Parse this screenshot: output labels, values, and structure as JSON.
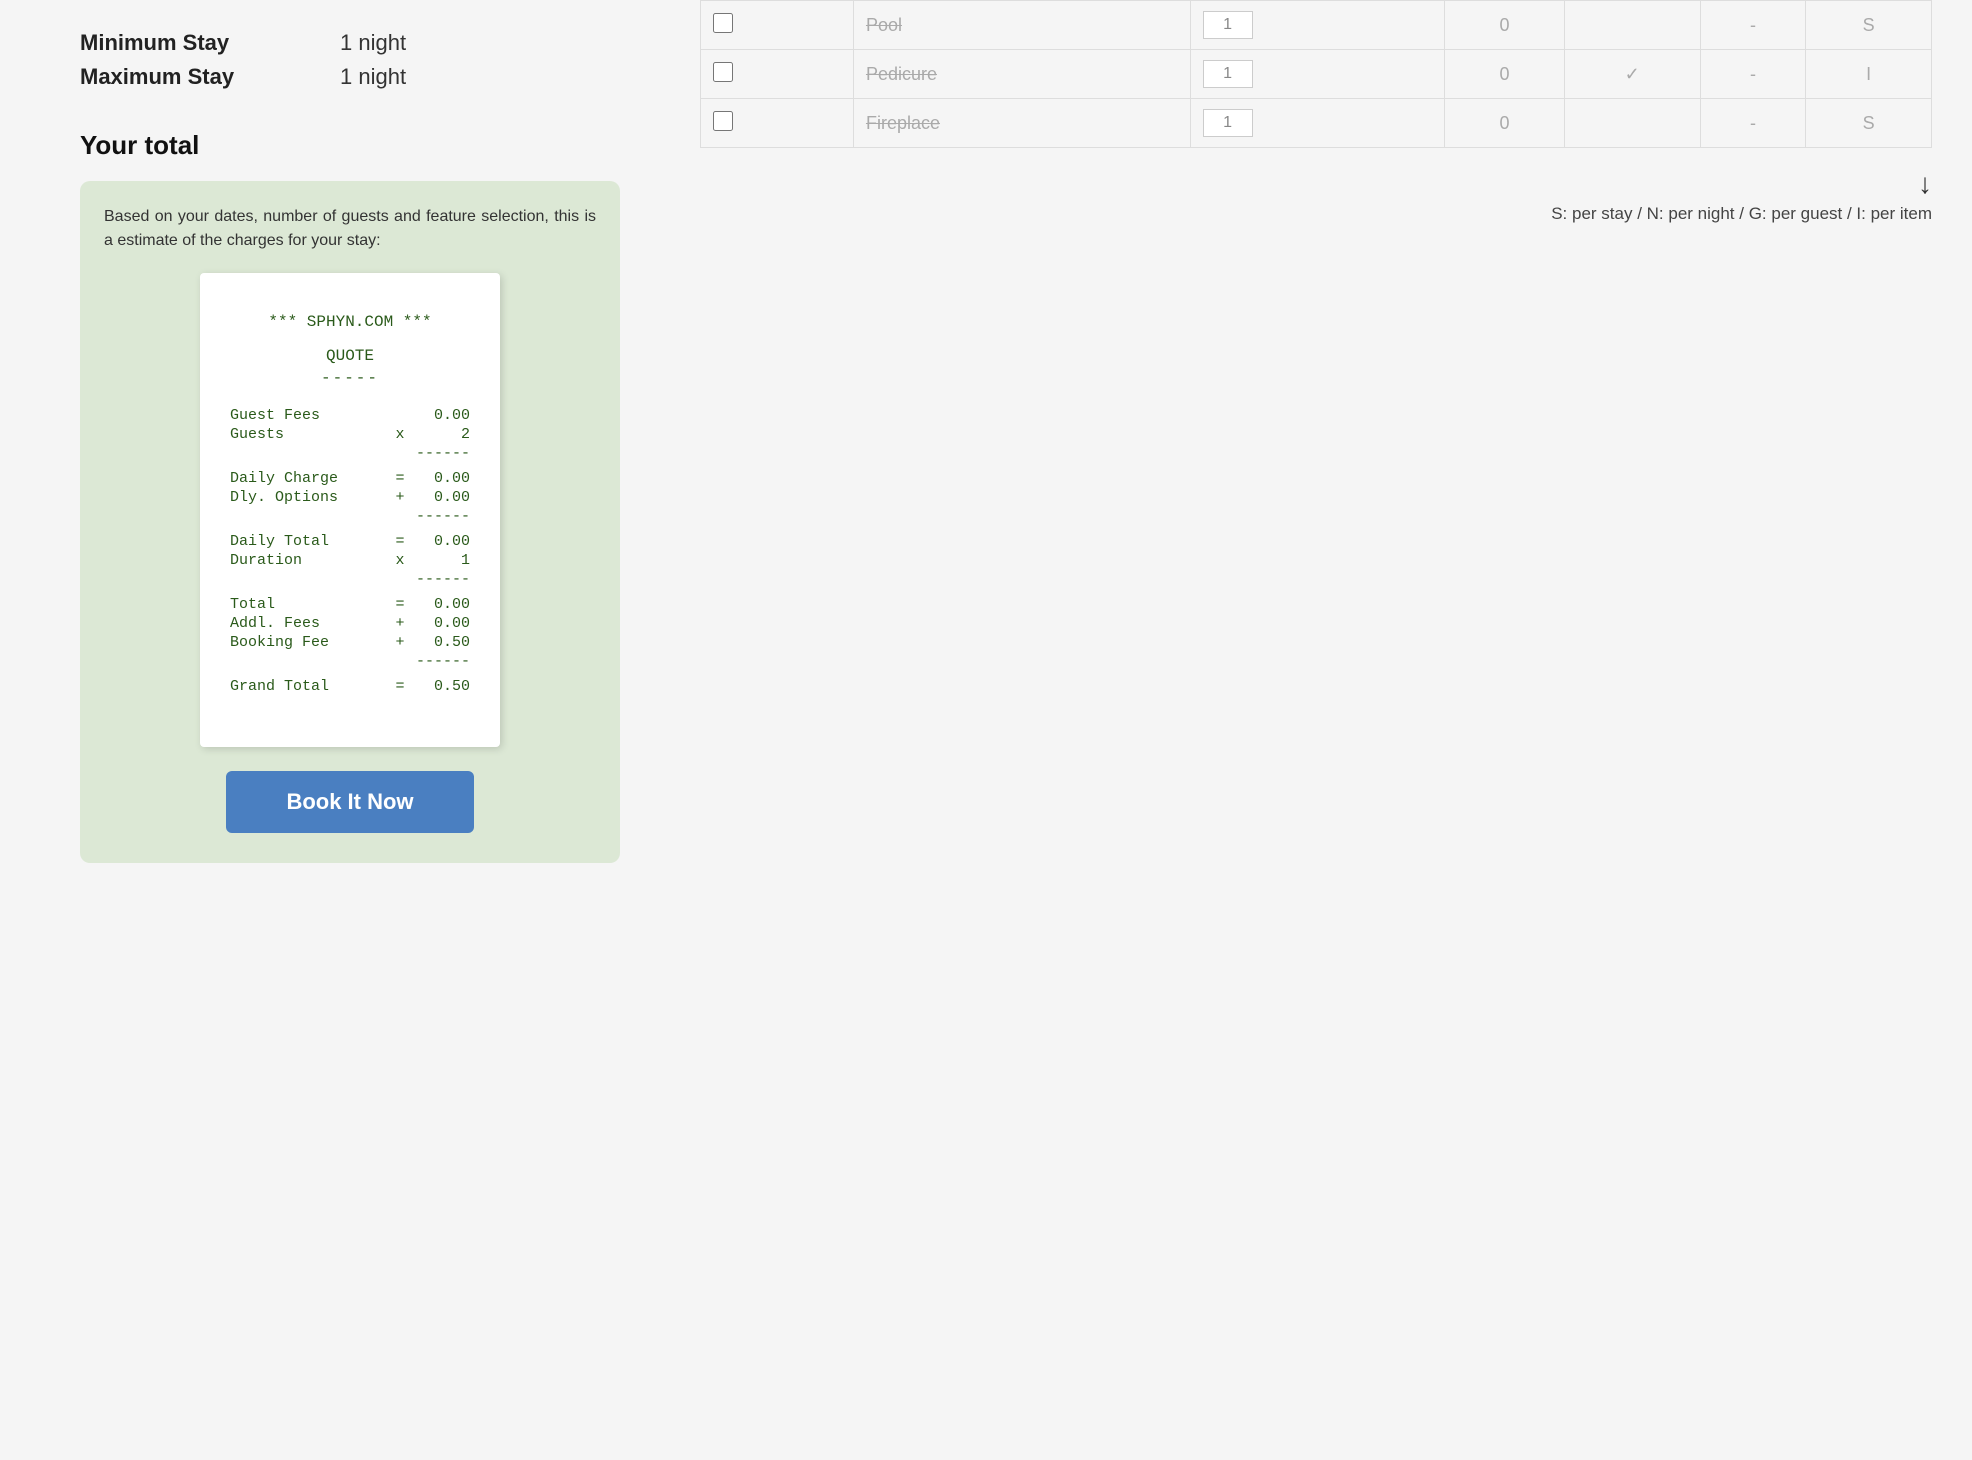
{
  "left": {
    "stay": {
      "min_label": "Minimum Stay",
      "min_value": "1 night",
      "max_label": "Maximum Stay",
      "max_value": "1 night"
    },
    "your_total_label": "Your total",
    "description": "Based on your dates, number of guests and feature selection, this is a estimate of the charges for your stay:",
    "receipt": {
      "header": "*** SPHYN.COM ***",
      "title": "QUOTE",
      "divider_short": "-----",
      "lines": [
        {
          "label": "Guest Fees",
          "op": "",
          "value": "0.00"
        },
        {
          "label": "Guests",
          "op": "x",
          "value": "2"
        },
        {
          "sep1": "------"
        },
        {
          "label": "Daily Charge",
          "op": "=",
          "value": "0.00"
        },
        {
          "label": "Dly. Options",
          "op": "+",
          "value": "0.00"
        },
        {
          "sep2": "------"
        },
        {
          "label": "Daily Total",
          "op": "=",
          "value": "0.00"
        },
        {
          "label": "Duration",
          "op": "x",
          "value": "1"
        },
        {
          "sep3": "------"
        },
        {
          "label": "Total",
          "op": "=",
          "value": "0.00"
        },
        {
          "label": "Addl. Fees",
          "op": "+",
          "value": "0.00"
        },
        {
          "label": "Booking Fee",
          "op": "+",
          "value": "0.50"
        },
        {
          "sep4": "------"
        },
        {
          "label": "Grand Total",
          "op": "=",
          "value": "0.50"
        }
      ]
    },
    "book_btn_label": "Book It Now"
  },
  "right": {
    "features": [
      {
        "name": "Pool",
        "qty": "1",
        "guests": "0",
        "checked": false,
        "type": "S"
      },
      {
        "name": "Pedicure",
        "qty": "1",
        "guests": "0",
        "checked": true,
        "type": "I"
      },
      {
        "name": "Fireplace",
        "qty": "1",
        "guests": "0",
        "checked": false,
        "type": "S"
      }
    ],
    "legend": "S: per stay / N: per night / G: per guest / I: per item"
  }
}
